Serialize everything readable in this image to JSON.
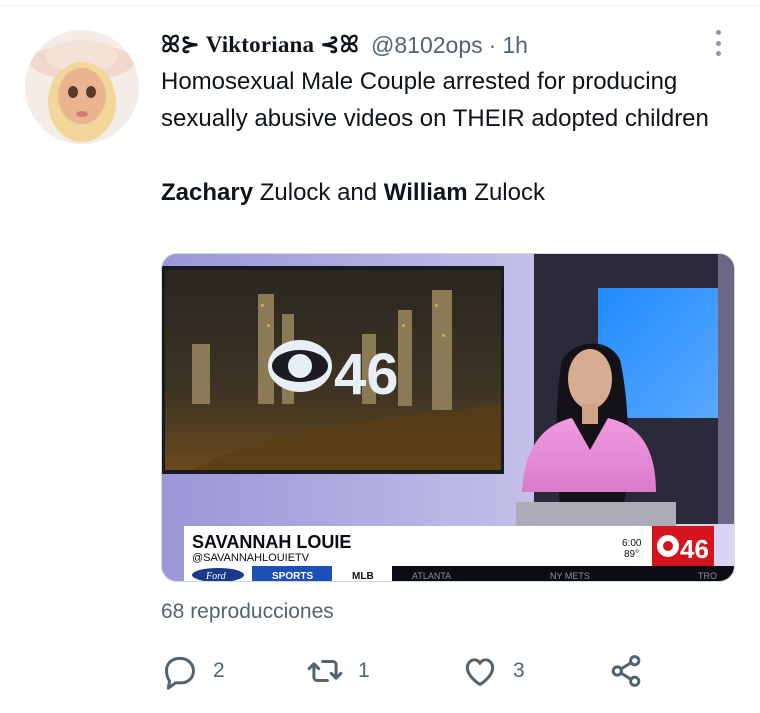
{
  "tweet": {
    "display_name": "Viktoriana",
    "handle": "@8102ops",
    "separator": "·",
    "time": "1h",
    "text_line1": "Homosexual Male Couple arrested for producing sexually abusive videos on THEIR adopted children",
    "text_name1_bold": "Zachary",
    "text_name1_rest": " Zulock and ",
    "text_name2_bold": "William",
    "text_name2_rest": " Zulock"
  },
  "media": {
    "station_logo": "46",
    "lower_third_name": "SAVANNAH LOUIE",
    "lower_third_handle": "@SAVANNAHLOUIETV",
    "ticker_brand": "Ford",
    "ticker_section": "SPORTS",
    "ticker_league": "MLB",
    "ticker_team1": "ATLANTA",
    "ticker_team2": "NY METS",
    "ticker_team3": "TRO",
    "time_display": "6:00",
    "temp_display": "89°",
    "colors": {
      "pink_dress": "#e88bd6",
      "tv_blue": "#2f8bff",
      "lower_third_red": "#d4151e"
    }
  },
  "stats": {
    "views": "68 reproducciones",
    "replies": "2",
    "retweets": "1",
    "likes": "3"
  },
  "icons": [
    "reply-icon",
    "retweet-icon",
    "like-icon",
    "share-icon",
    "more-options-icon"
  ],
  "colors": {
    "text_primary": "#0f1419",
    "text_secondary": "#536471"
  }
}
